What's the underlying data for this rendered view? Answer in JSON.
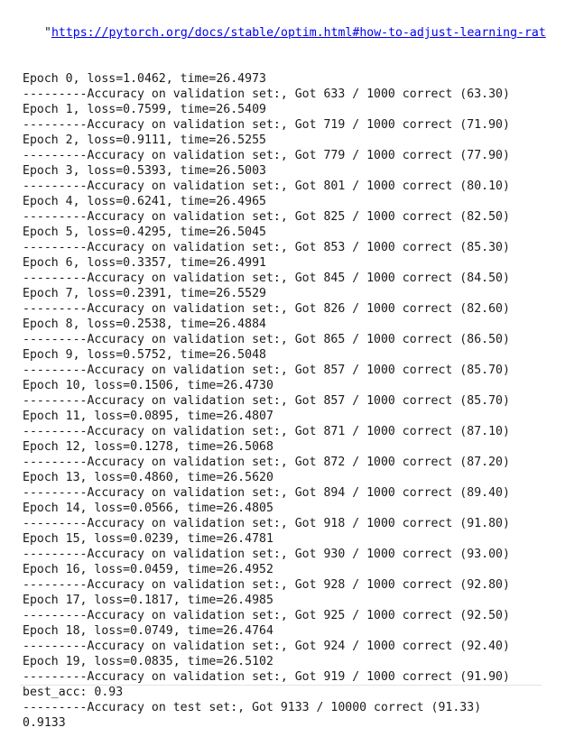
{
  "url_prefix": "\"",
  "url_text": "https://pytorch.org/docs/stable/optim.html#how-to-adjust-learning-rat",
  "lines": [
    "Epoch 0, loss=1.0462, time=26.4973",
    "---------Accuracy on validation set:, Got 633 / 1000 correct (63.30)",
    "Epoch 1, loss=0.7599, time=26.5409",
    "---------Accuracy on validation set:, Got 719 / 1000 correct (71.90)",
    "Epoch 2, loss=0.9111, time=26.5255",
    "---------Accuracy on validation set:, Got 779 / 1000 correct (77.90)",
    "Epoch 3, loss=0.5393, time=26.5003",
    "---------Accuracy on validation set:, Got 801 / 1000 correct (80.10)",
    "Epoch 4, loss=0.6241, time=26.4965",
    "---------Accuracy on validation set:, Got 825 / 1000 correct (82.50)",
    "Epoch 5, loss=0.4295, time=26.5045",
    "---------Accuracy on validation set:, Got 853 / 1000 correct (85.30)",
    "Epoch 6, loss=0.3357, time=26.4991",
    "---------Accuracy on validation set:, Got 845 / 1000 correct (84.50)",
    "Epoch 7, loss=0.2391, time=26.5529",
    "---------Accuracy on validation set:, Got 826 / 1000 correct (82.60)",
    "Epoch 8, loss=0.2538, time=26.4884",
    "---------Accuracy on validation set:, Got 865 / 1000 correct (86.50)",
    "Epoch 9, loss=0.5752, time=26.5048",
    "---------Accuracy on validation set:, Got 857 / 1000 correct (85.70)",
    "Epoch 10, loss=0.1506, time=26.4730",
    "---------Accuracy on validation set:, Got 857 / 1000 correct (85.70)",
    "Epoch 11, loss=0.0895, time=26.4807",
    "---------Accuracy on validation set:, Got 871 / 1000 correct (87.10)",
    "Epoch 12, loss=0.1278, time=26.5068",
    "---------Accuracy on validation set:, Got 872 / 1000 correct (87.20)",
    "Epoch 13, loss=0.4860, time=26.5620",
    "---------Accuracy on validation set:, Got 894 / 1000 correct (89.40)",
    "Epoch 14, loss=0.0566, time=26.4805",
    "---------Accuracy on validation set:, Got 918 / 1000 correct (91.80)",
    "Epoch 15, loss=0.0239, time=26.4781",
    "---------Accuracy on validation set:, Got 930 / 1000 correct (93.00)",
    "Epoch 16, loss=0.0459, time=26.4952",
    "---------Accuracy on validation set:, Got 928 / 1000 correct (92.80)",
    "Epoch 17, loss=0.1817, time=26.4985",
    "---------Accuracy on validation set:, Got 925 / 1000 correct (92.50)",
    "Epoch 18, loss=0.0749, time=26.4764",
    "---------Accuracy on validation set:, Got 924 / 1000 correct (92.40)",
    "Epoch 19, loss=0.0835, time=26.5102",
    "---------Accuracy on validation set:, Got 919 / 1000 correct (91.90)",
    "best_acc: 0.93",
    "---------Accuracy on test set:, Got 9133 / 10000 correct (91.33)",
    "0.9133"
  ]
}
